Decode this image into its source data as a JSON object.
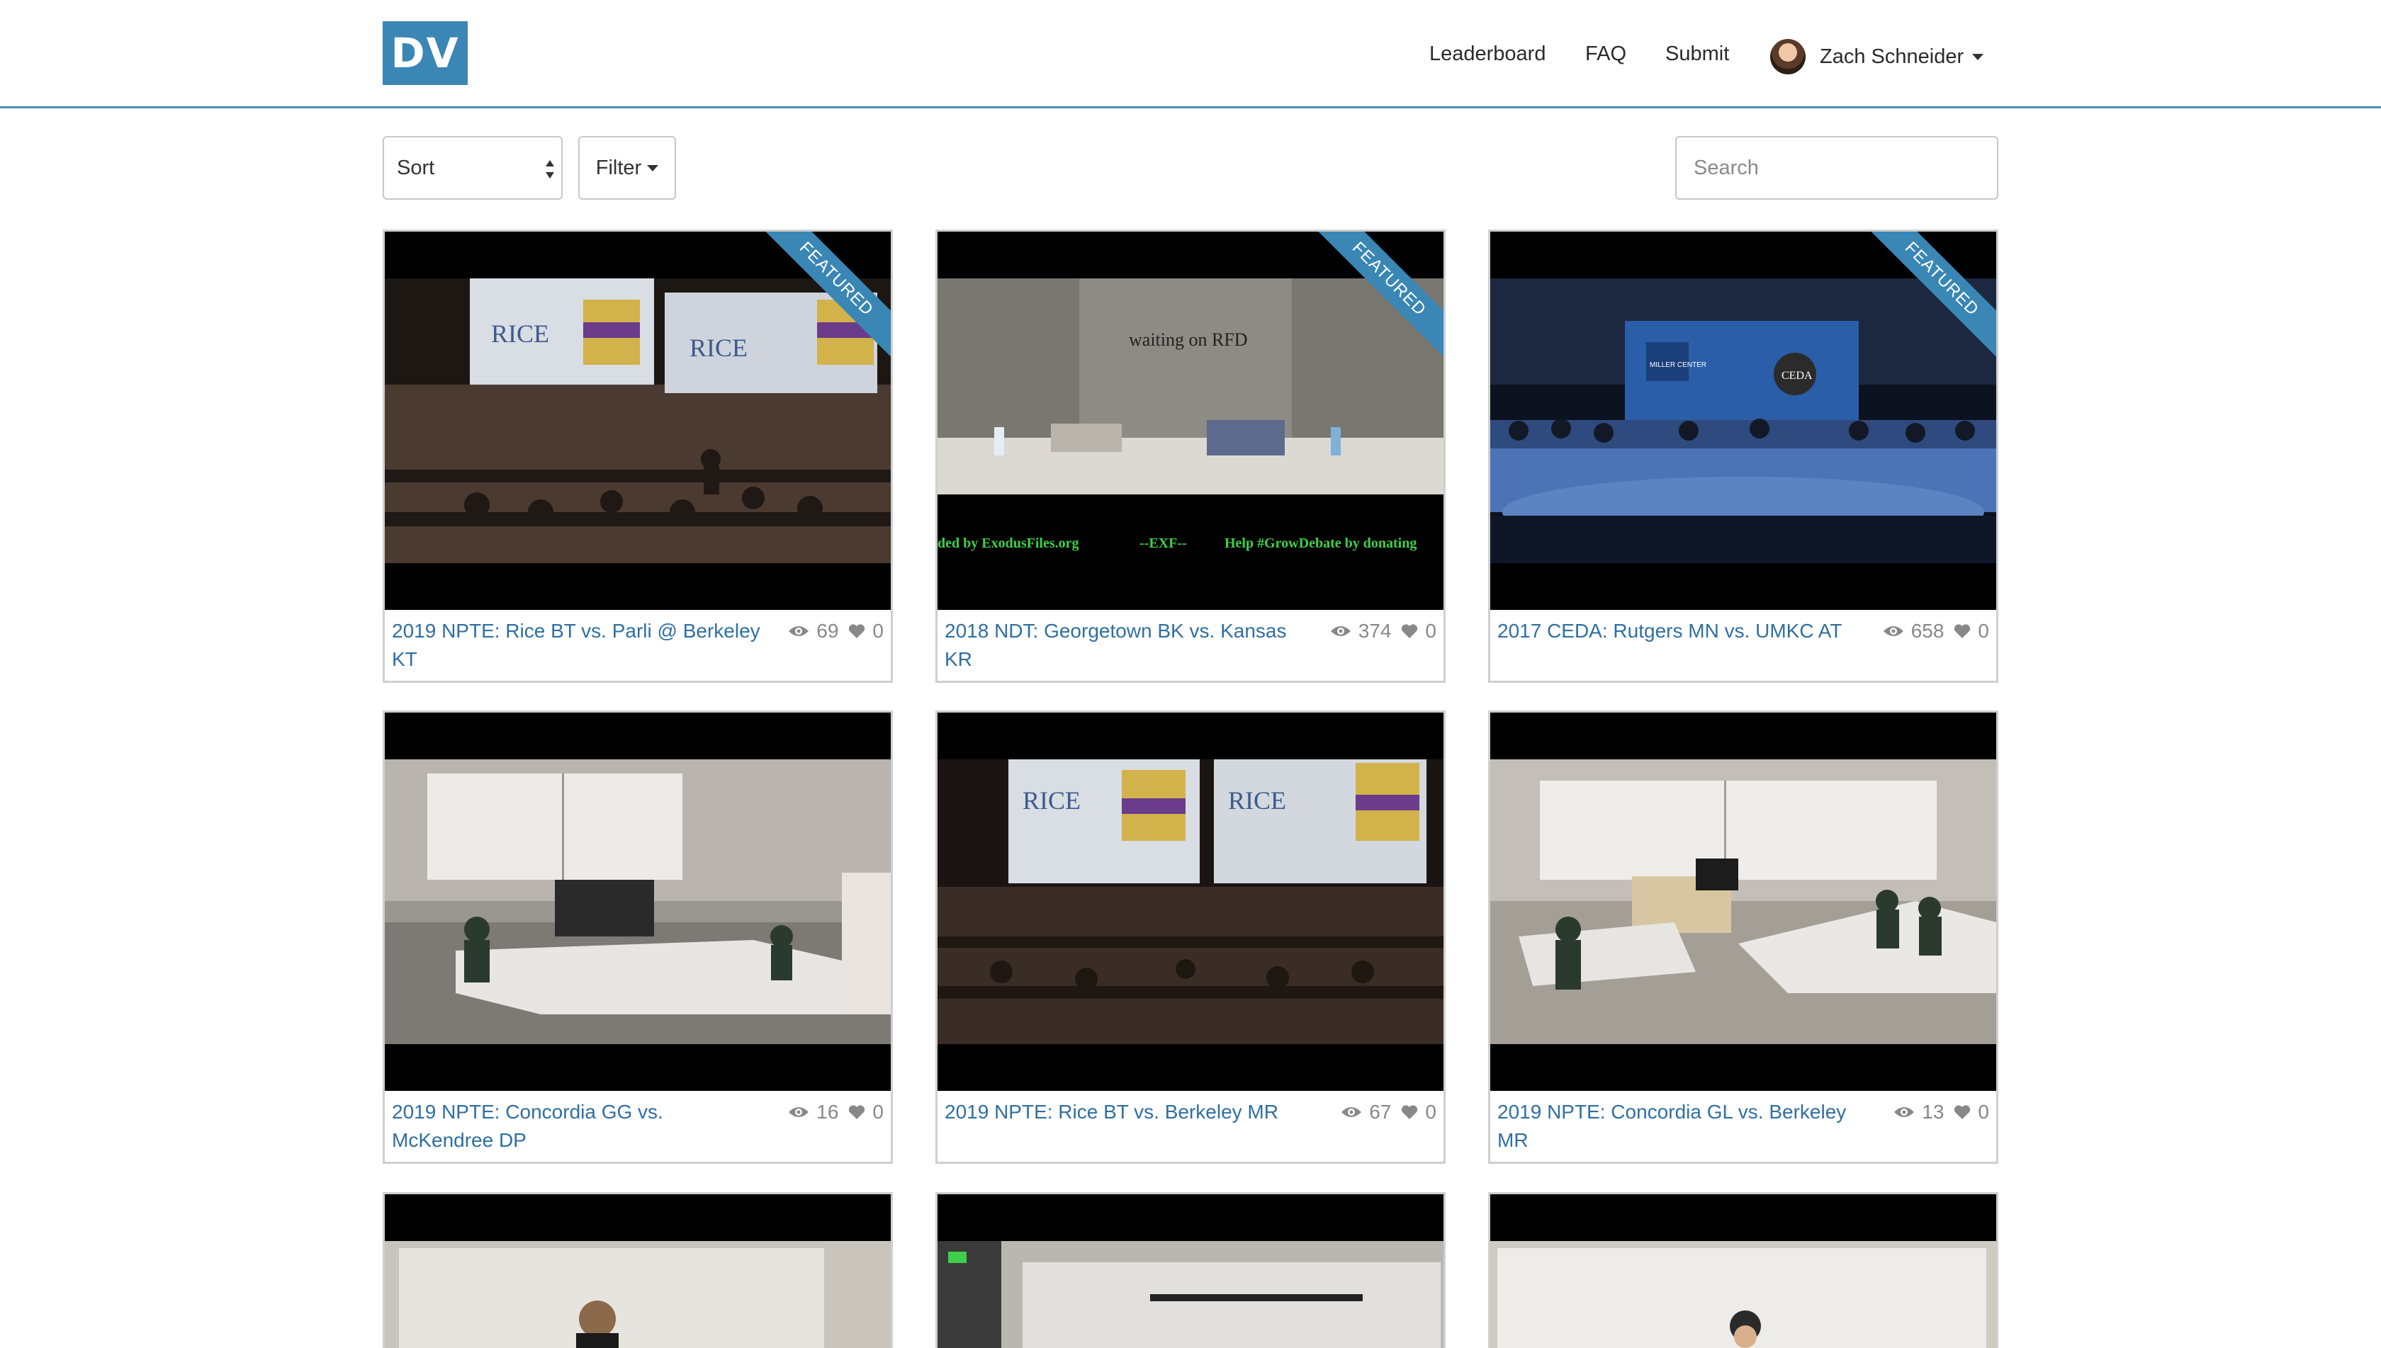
{
  "header": {
    "logo": "DV",
    "nav": {
      "leaderboard": "Leaderboard",
      "faq": "FAQ",
      "submit": "Submit"
    },
    "user": {
      "name": "Zach Schneider"
    }
  },
  "toolbar": {
    "sort_label": "Sort",
    "filter_label": "Filter",
    "search_placeholder": "Search"
  },
  "videos": [
    {
      "title": "2019 NPTE: Rice BT vs. Parli @ Berkeley KT",
      "views": "69",
      "likes": "0",
      "featured": "FEATURED"
    },
    {
      "title": "2018 NDT: Georgetown BK vs. Kansas KR",
      "views": "374",
      "likes": "0",
      "featured": "FEATURED"
    },
    {
      "title": "2017 CEDA: Rutgers MN vs. UMKC AT",
      "views": "658",
      "likes": "0",
      "featured": "FEATURED"
    },
    {
      "title": "2019 NPTE: Concordia GG vs. McKendree DP",
      "views": "16",
      "likes": "0"
    },
    {
      "title": "2019 NPTE: Rice BT vs. Berkeley MR",
      "views": "67",
      "likes": "0"
    },
    {
      "title": "2019 NPTE: Concordia GL vs. Berkeley MR",
      "views": "13",
      "likes": "0"
    }
  ],
  "thumb_text": {
    "rice_logo": "RICE",
    "waiting": "waiting on RFD",
    "exodus_left": "ded by ExodusFiles.org",
    "exodus_mid": "--EXF--",
    "exodus_right": "Help #GrowDebate by donating",
    "ceda": "CEDA",
    "miller": "MILLER CENTER"
  },
  "colors": {
    "brand": "#3a86b5",
    "link": "#2f6fa3",
    "muted": "#888888"
  }
}
